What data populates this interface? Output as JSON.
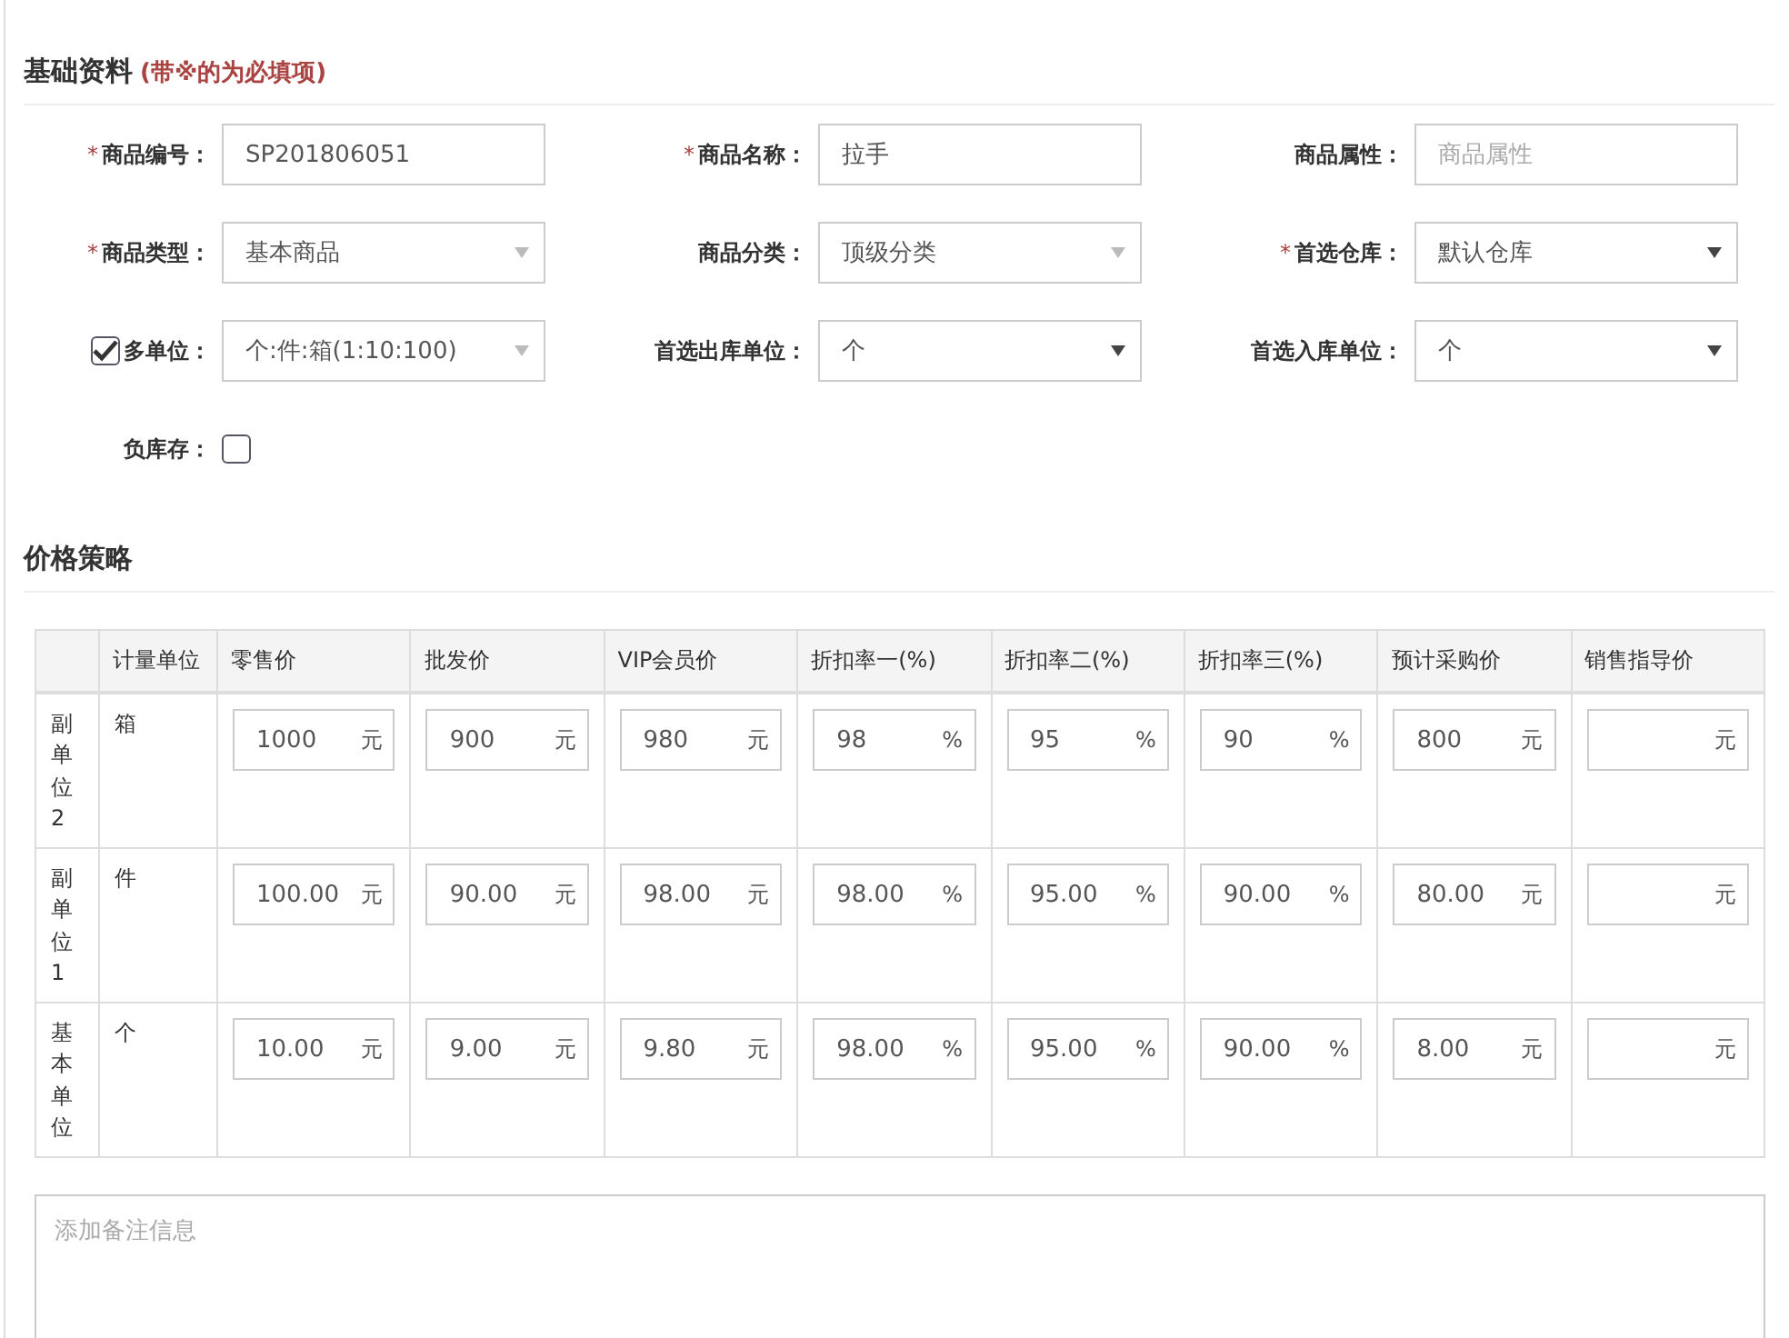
{
  "basic": {
    "title": "基础资料",
    "note": "(带※的为必填项)",
    "fields": [
      {
        "kind": "text",
        "mark": "*",
        "label": "商品编号：",
        "value": "SP201806051"
      },
      {
        "kind": "text",
        "mark": "*",
        "label": "商品名称：",
        "value": "拉手"
      },
      {
        "kind": "text",
        "label": "商品属性：",
        "placeholder": "商品属性"
      },
      {
        "kind": "select",
        "mark": "*",
        "label": "商品类型：",
        "value": "基本商品",
        "disabled": true
      },
      {
        "kind": "select",
        "label": "商品分类：",
        "value": "顶级分类",
        "disabled": true
      },
      {
        "kind": "select",
        "mark": "*",
        "label": "首选仓库：",
        "value": "默认仓库",
        "disabled": false
      },
      {
        "kind": "select",
        "label": "多单位：",
        "value": "个:件:箱(1:10:100)",
        "disabled": true,
        "checked": true
      },
      {
        "kind": "select",
        "label": "首选出库单位：",
        "value": "个",
        "disabled": false
      },
      {
        "kind": "select",
        "label": "首选入库单位：",
        "value": "个",
        "disabled": false
      },
      {
        "kind": "checkbox",
        "label": "负库存：",
        "checked": false
      }
    ]
  },
  "pricing": {
    "title": "价格策略",
    "columns": [
      "",
      "计量单位",
      "零售价",
      "批发价",
      "VIP会员价",
      "折扣率一(%)",
      "折扣率二(%)",
      "折扣率三(%)",
      "预计采购价",
      "销售指导价"
    ],
    "rows": [
      {
        "cells": [
          {
            "kind": "group",
            "text": "副单位2"
          },
          {
            "kind": "unit",
            "text": "箱"
          },
          {
            "kind": "price",
            "value": "1000",
            "suffix": "元"
          },
          {
            "kind": "price",
            "value": "900",
            "suffix": "元"
          },
          {
            "kind": "price",
            "value": "980",
            "suffix": "元"
          },
          {
            "kind": "price",
            "value": "98",
            "suffix": "%"
          },
          {
            "kind": "price",
            "value": "95",
            "suffix": "%"
          },
          {
            "kind": "price",
            "value": "90",
            "suffix": "%"
          },
          {
            "kind": "price",
            "value": "800",
            "suffix": "元"
          },
          {
            "kind": "price",
            "suffix": "元"
          }
        ]
      },
      {
        "cells": [
          {
            "kind": "group",
            "text": "副单位1"
          },
          {
            "kind": "unit",
            "text": "件"
          },
          {
            "kind": "price",
            "value": "100.00",
            "suffix": "元"
          },
          {
            "kind": "price",
            "value": "90.00",
            "suffix": "元"
          },
          {
            "kind": "price",
            "value": "98.00",
            "suffix": "元"
          },
          {
            "kind": "price",
            "value": "98.00",
            "suffix": "%"
          },
          {
            "kind": "price",
            "value": "95.00",
            "suffix": "%"
          },
          {
            "kind": "price",
            "value": "90.00",
            "suffix": "%"
          },
          {
            "kind": "price",
            "value": "80.00",
            "suffix": "元"
          },
          {
            "kind": "price",
            "suffix": "元"
          }
        ]
      },
      {
        "cells": [
          {
            "kind": "group",
            "text": "基本单位"
          },
          {
            "kind": "unit",
            "text": "个"
          },
          {
            "kind": "price",
            "value": "10.00",
            "suffix": "元"
          },
          {
            "kind": "price",
            "value": "9.00",
            "suffix": "元"
          },
          {
            "kind": "price",
            "value": "9.80",
            "suffix": "元"
          },
          {
            "kind": "price",
            "value": "98.00",
            "suffix": "%"
          },
          {
            "kind": "price",
            "value": "95.00",
            "suffix": "%"
          },
          {
            "kind": "price",
            "value": "90.00",
            "suffix": "%"
          },
          {
            "kind": "price",
            "value": "8.00",
            "suffix": "元"
          },
          {
            "kind": "price",
            "suffix": "元"
          }
        ]
      }
    ]
  },
  "remarks": {
    "placeholder": "添加备注信息"
  }
}
